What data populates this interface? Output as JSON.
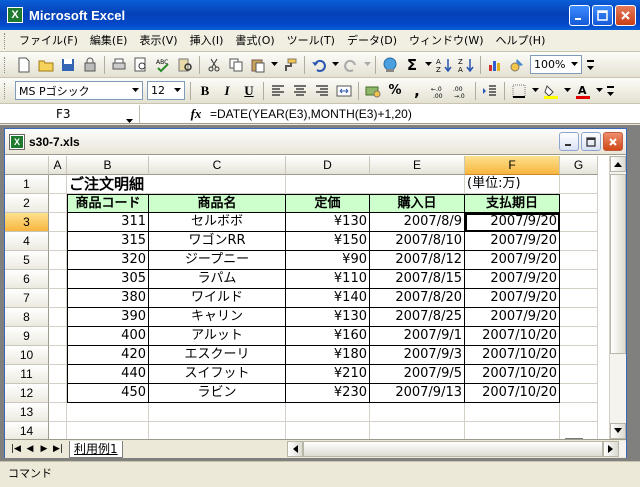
{
  "window": {
    "title": "Microsoft Excel"
  },
  "menu": [
    "ファイル(F)",
    "編集(E)",
    "表示(V)",
    "挿入(I)",
    "書式(O)",
    "ツール(T)",
    "データ(D)",
    "ウィンドウ(W)",
    "ヘルプ(H)"
  ],
  "toolbar": {
    "zoom": "100%",
    "font_name": "MS Pゴシック",
    "font_size": "12",
    "bold": "B",
    "italic": "I",
    "underline": "U",
    "percent": "%",
    "comma": ",",
    "sigma": "Σ"
  },
  "formula_bar": {
    "name_box": "F3",
    "fx": "fx",
    "formula": "=DATE(YEAR(E3),MONTH(E3)+1,20)"
  },
  "document": {
    "title": "s30-7.xls"
  },
  "grid": {
    "columns": [
      "A",
      "B",
      "C",
      "D",
      "E",
      "F",
      "G"
    ],
    "selected_column": "F",
    "selected_row": "3",
    "active_cell": "F3",
    "rows": [
      {
        "num": "1",
        "title": "ご注文明細",
        "note": "(単位:万)"
      },
      {
        "num": "2",
        "headers": [
          "商品コード",
          "商品名",
          "定価",
          "購入日",
          "支払期日"
        ]
      },
      {
        "num": "3",
        "cells": [
          "311",
          "セルボボ",
          "¥130",
          "2007/8/9",
          "2007/9/20"
        ]
      },
      {
        "num": "4",
        "cells": [
          "315",
          "ワゴンRR",
          "¥150",
          "2007/8/10",
          "2007/9/20"
        ]
      },
      {
        "num": "5",
        "cells": [
          "320",
          "ジープニー",
          "¥90",
          "2007/8/12",
          "2007/9/20"
        ]
      },
      {
        "num": "6",
        "cells": [
          "305",
          "ラパム",
          "¥110",
          "2007/8/15",
          "2007/9/20"
        ]
      },
      {
        "num": "7",
        "cells": [
          "380",
          "ワイルド",
          "¥140",
          "2007/8/20",
          "2007/9/20"
        ]
      },
      {
        "num": "8",
        "cells": [
          "390",
          "キャリン",
          "¥130",
          "2007/8/25",
          "2007/9/20"
        ]
      },
      {
        "num": "9",
        "cells": [
          "400",
          "アルット",
          "¥160",
          "2007/9/1",
          "2007/10/20"
        ]
      },
      {
        "num": "10",
        "cells": [
          "420",
          "エスクーリ",
          "¥180",
          "2007/9/3",
          "2007/10/20"
        ]
      },
      {
        "num": "11",
        "cells": [
          "440",
          "スイフット",
          "¥210",
          "2007/9/5",
          "2007/10/20"
        ]
      },
      {
        "num": "12",
        "cells": [
          "450",
          "ラビン",
          "¥230",
          "2007/9/13",
          "2007/10/20"
        ]
      },
      {
        "num": "13"
      },
      {
        "num": "14"
      }
    ]
  },
  "sheet_tabs": [
    "利用例1"
  ],
  "status": {
    "mode": "コマンド"
  },
  "colors": {
    "title_blue": "#0441b7",
    "header_green": "#ccffcc",
    "selected_header": "#f8b53f"
  }
}
